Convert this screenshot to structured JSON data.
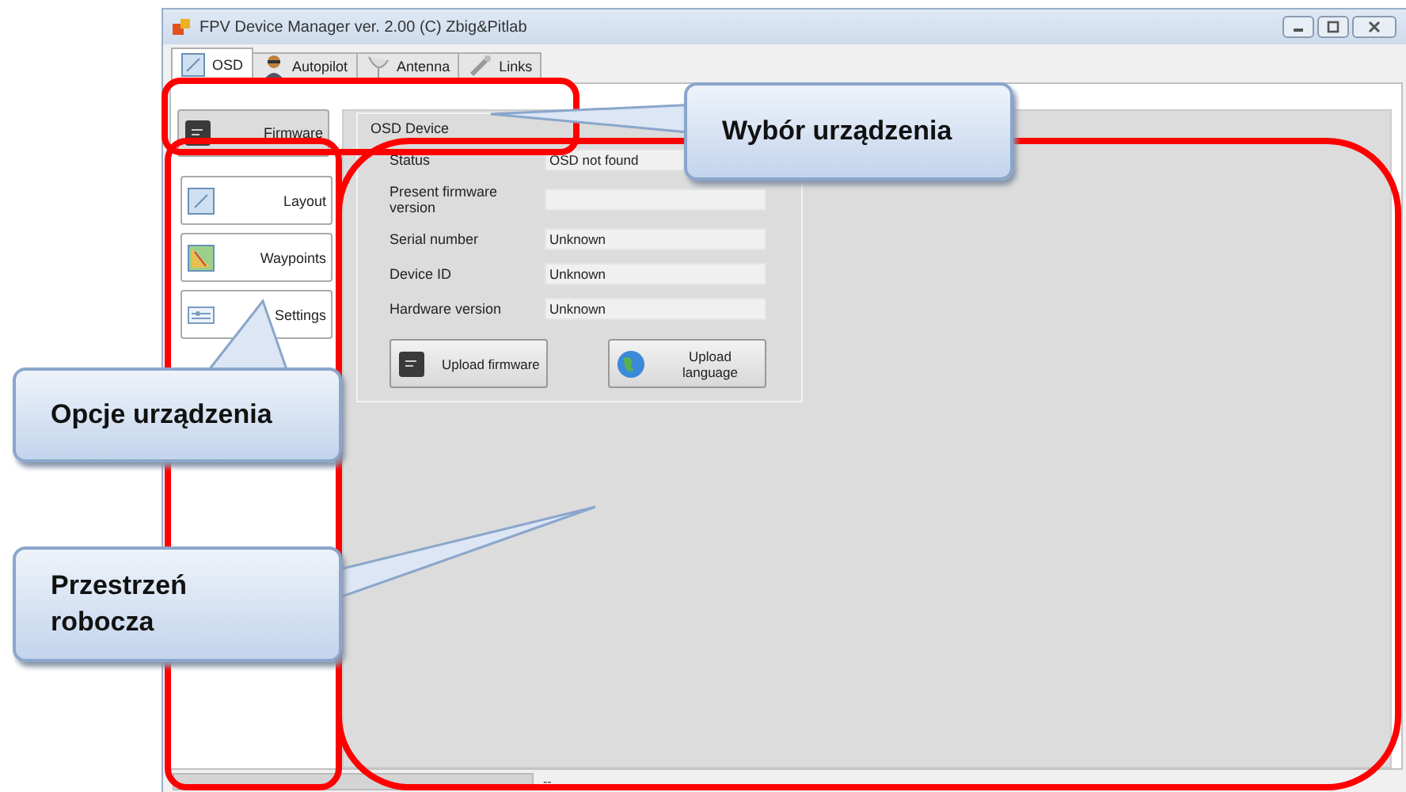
{
  "window": {
    "title": "FPV Device Manager ver. 2.00 (C) Zbig&Pitlab"
  },
  "tabs": [
    {
      "label": "OSD",
      "selected": true,
      "kind": "osd"
    },
    {
      "label": "Autopilot",
      "selected": false,
      "kind": "autopilot"
    },
    {
      "label": "Antenna",
      "selected": false,
      "kind": "antenna"
    },
    {
      "label": "Links",
      "selected": false,
      "kind": "links"
    }
  ],
  "device_selector": {
    "label": "Firmware",
    "selected": true
  },
  "sidebar": {
    "items": [
      {
        "label": "Layout",
        "selected": false,
        "kind": "layout"
      },
      {
        "label": "Waypoints",
        "selected": false,
        "kind": "waypoints"
      },
      {
        "label": "Settings",
        "selected": false,
        "kind": "settings"
      }
    ]
  },
  "panel": {
    "title": "OSD Device",
    "fields": [
      {
        "label": "Status",
        "value": "OSD not found"
      },
      {
        "label": "Present firmware version"
      },
      {
        "label": "Serial number",
        "value": "Unknown"
      },
      {
        "label": "Device ID",
        "value": "Unknown"
      },
      {
        "label": "Hardware version",
        "value": "Unknown"
      }
    ],
    "buttons": [
      {
        "label": "Upload firmware",
        "kind": "chip"
      },
      {
        "label": "Upload language",
        "kind": "globe"
      }
    ]
  },
  "status_bar": {
    "progress": {
      "level": 0
    },
    "text": "--"
  },
  "annotations": [
    {
      "text": "Wybór urządzenia"
    },
    {
      "text": "Opcje urządzenia"
    },
    {
      "text": "Przestrzeń robocza"
    }
  ]
}
